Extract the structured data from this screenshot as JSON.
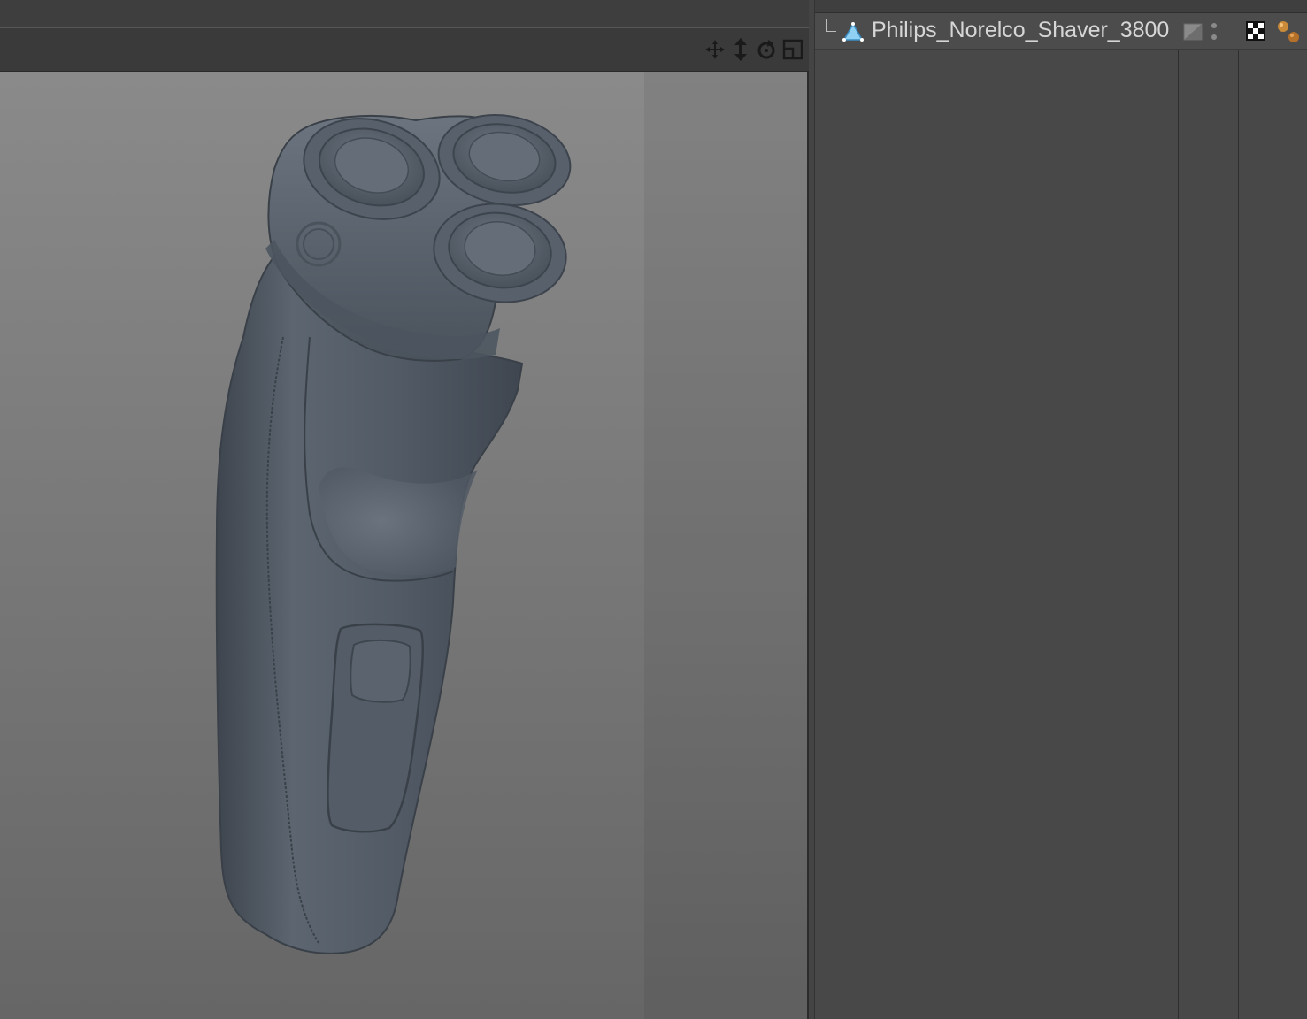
{
  "object_manager": {
    "object_name": "Philips_Norelco_Shaver_3800",
    "tags": [
      {
        "icon": "phong-checker-icon"
      },
      {
        "icon": "material-icon"
      }
    ]
  },
  "viewport": {
    "nav_icons": [
      "move-icon",
      "dolly-icon",
      "rotate-icon",
      "maximize-icon"
    ],
    "model_color": "#545d68",
    "background_color": "#7f7f7f"
  }
}
